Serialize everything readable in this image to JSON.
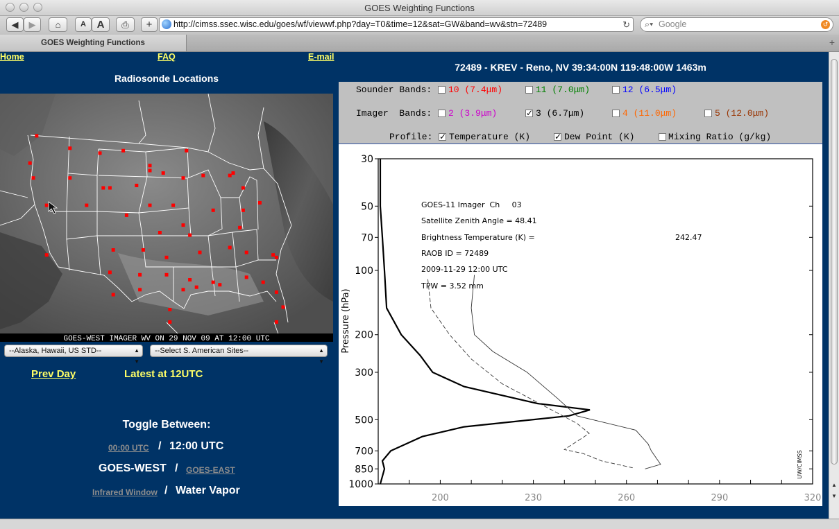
{
  "browser": {
    "window_title": "GOES Weighting Functions",
    "url": "http://cimss.ssec.wisc.edu/goes/wf/viewwf.php?day=T0&time=12&sat=GW&band=wv&stn=72489",
    "search_placeholder": "Google",
    "tab_title": "GOES Weighting Functions",
    "font_small": "A",
    "font_large": "A",
    "new_tab": "+",
    "plus_tab": "+"
  },
  "nav": {
    "home": "Home",
    "faq": "FAQ",
    "email": "E-mail"
  },
  "left": {
    "map_title": "Radiosonde Locations",
    "map_caption": "GOES-WEST IMAGER WV ON 29 NOV 09 AT 12:00 UTC",
    "select_alaska": "--Alaska, Hawaii, US STD--",
    "select_sa": "--Select S. American Sites--",
    "prev_day": "Prev Day",
    "latest": "Latest at 12UTC",
    "toggle_title": "Toggle Between:",
    "time_other": "00:00 UTC",
    "time_current": "12:00 UTC",
    "sat_current": "GOES-WEST",
    "sat_other": "GOES-EAST",
    "type_other": "Infrared Window",
    "type_current": "Water Vapor",
    "separator": "/"
  },
  "station_header": "72489 - KREV - Reno, NV 39:34:00N 119:48:00W 1463m",
  "controls": {
    "sounder_label": "Sounder Bands:",
    "imager_label": "Imager  Bands:",
    "profile_label": "Profile:",
    "sounder_bands": [
      {
        "label": "10",
        "wl": "(7.4μm)",
        "color": "#ff0000",
        "checked": false
      },
      {
        "label": "11",
        "wl": "(7.0μm)",
        "color": "#008000",
        "checked": false
      },
      {
        "label": "12",
        "wl": "(6.5μm)",
        "color": "#0000ff",
        "checked": false
      }
    ],
    "imager_bands": [
      {
        "label": "2",
        "wl": "(3.9μm)",
        "color": "#cc00cc",
        "checked": false
      },
      {
        "label": "3",
        "wl": "(6.7μm)",
        "color": "#000000",
        "checked": true
      },
      {
        "label": "4",
        "wl": "(11.0μm)",
        "color": "#ff6600",
        "checked": false
      },
      {
        "label": "5",
        "wl": "(12.0μm)",
        "color": "#993300",
        "checked": false
      }
    ],
    "profiles": [
      {
        "label": "Temperature (K)",
        "checked": true
      },
      {
        "label": "Dew Point (K)",
        "checked": true
      },
      {
        "label": "Mixing Ratio (g/kg)",
        "checked": false
      }
    ]
  },
  "plot": {
    "info": [
      "GOES-11 Imager  Ch     03",
      "Satellite Zenith Angle = 48.41",
      "Brightness Temperature (K) =",
      "RAOB ID = 72489",
      "2009-11-29 12:00 UTC",
      "TPW = 3.52 mm"
    ],
    "bt_value": "242.47",
    "ylabel": "Pressure (hPa)",
    "watermark": "UW/CIMSS",
    "pressure_ticks": [
      "30",
      "50",
      "70",
      "100",
      "200",
      "300",
      "500",
      "700",
      "850",
      "1000"
    ],
    "temp_ticks": [
      "200",
      "230",
      "260",
      "290",
      "320"
    ]
  },
  "chart_data": {
    "type": "line",
    "title": "",
    "xlabel": "",
    "ylabel": "Pressure (hPa)",
    "y_scale": "log",
    "ylim": [
      1000,
      30
    ],
    "temp_xlim": [
      180,
      320
    ],
    "series": [
      {
        "name": "",
        "role": "weighting_function",
        "points": [
          [
            0.0,
            30
          ],
          [
            0.0,
            50
          ],
          [
            0.01,
            70
          ],
          [
            0.02,
            100
          ],
          [
            0.03,
            150
          ],
          [
            0.1,
            200
          ],
          [
            0.19,
            250
          ],
          [
            0.25,
            300
          ],
          [
            0.4,
            350
          ],
          [
            0.75,
            420
          ],
          [
            1.0,
            450
          ],
          [
            0.9,
            480
          ],
          [
            0.4,
            540
          ],
          [
            0.2,
            600
          ],
          [
            0.05,
            700
          ],
          [
            0.01,
            780
          ],
          [
            0.02,
            850
          ],
          [
            0.0,
            1000
          ]
        ]
      },
      {
        "name": "",
        "role": "temperature",
        "points": [
          [
            211,
            105
          ],
          [
            210,
            150
          ],
          [
            211,
            200
          ],
          [
            217,
            240
          ],
          [
            228,
            300
          ],
          [
            238,
            400
          ],
          [
            244,
            480
          ],
          [
            263,
            560
          ],
          [
            267,
            650
          ],
          [
            268,
            700
          ],
          [
            271,
            810
          ],
          [
            266,
            850
          ]
        ]
      },
      {
        "name": "",
        "role": "dew_point",
        "points": [
          [
            196,
            110
          ],
          [
            197,
            150
          ],
          [
            203,
            200
          ],
          [
            210,
            260
          ],
          [
            220,
            340
          ],
          [
            232,
            420
          ],
          [
            244,
            520
          ],
          [
            248,
            580
          ],
          [
            240,
            690
          ],
          [
            246,
            720
          ],
          [
            252,
            780
          ],
          [
            262,
            840
          ]
        ]
      }
    ],
    "annotations": {
      "brightness_temperature": 242.47,
      "tpw_mm": 3.52,
      "satellite_zenith_angle": 48.41
    }
  },
  "colors": {
    "page_bg": "#003366",
    "link_yellow": "#ffff66",
    "panel_gray": "#c0c0c0",
    "station_dot": "#ff0000"
  },
  "stations": [
    [
      0.11,
      0.17
    ],
    [
      0.21,
      0.22
    ],
    [
      0.3,
      0.24
    ],
    [
      0.37,
      0.23
    ],
    [
      0.45,
      0.29
    ],
    [
      0.56,
      0.23
    ],
    [
      0.69,
      0.33
    ],
    [
      0.09,
      0.28
    ],
    [
      0.21,
      0.34
    ],
    [
      0.1,
      0.34
    ],
    [
      0.31,
      0.38
    ],
    [
      0.33,
      0.38
    ],
    [
      0.41,
      0.37
    ],
    [
      0.45,
      0.31
    ],
    [
      0.49,
      0.32
    ],
    [
      0.55,
      0.34
    ],
    [
      0.61,
      0.33
    ],
    [
      0.7,
      0.32
    ],
    [
      0.73,
      0.38
    ],
    [
      0.14,
      0.45
    ],
    [
      0.26,
      0.45
    ],
    [
      0.38,
      0.49
    ],
    [
      0.45,
      0.45
    ],
    [
      0.52,
      0.45
    ],
    [
      0.64,
      0.47
    ],
    [
      0.73,
      0.47
    ],
    [
      0.78,
      0.44
    ],
    [
      0.72,
      0.54
    ],
    [
      0.55,
      0.53
    ],
    [
      0.57,
      0.57
    ],
    [
      0.48,
      0.56
    ],
    [
      0.74,
      0.64
    ],
    [
      0.82,
      0.65
    ],
    [
      0.34,
      0.63
    ],
    [
      0.43,
      0.63
    ],
    [
      0.5,
      0.66
    ],
    [
      0.6,
      0.64
    ],
    [
      0.69,
      0.62
    ],
    [
      0.59,
      0.78
    ],
    [
      0.83,
      0.66
    ],
    [
      0.14,
      0.65
    ],
    [
      0.33,
      0.72
    ],
    [
      0.42,
      0.73
    ],
    [
      0.5,
      0.73
    ],
    [
      0.57,
      0.75
    ],
    [
      0.64,
      0.76
    ],
    [
      0.66,
      0.77
    ],
    [
      0.74,
      0.74
    ],
    [
      0.79,
      0.76
    ],
    [
      0.83,
      0.8
    ],
    [
      0.55,
      0.79
    ],
    [
      0.42,
      0.79
    ],
    [
      0.34,
      0.81
    ],
    [
      0.51,
      0.87
    ],
    [
      0.85,
      0.86
    ],
    [
      0.51,
      0.92
    ],
    [
      0.83,
      0.92
    ]
  ]
}
